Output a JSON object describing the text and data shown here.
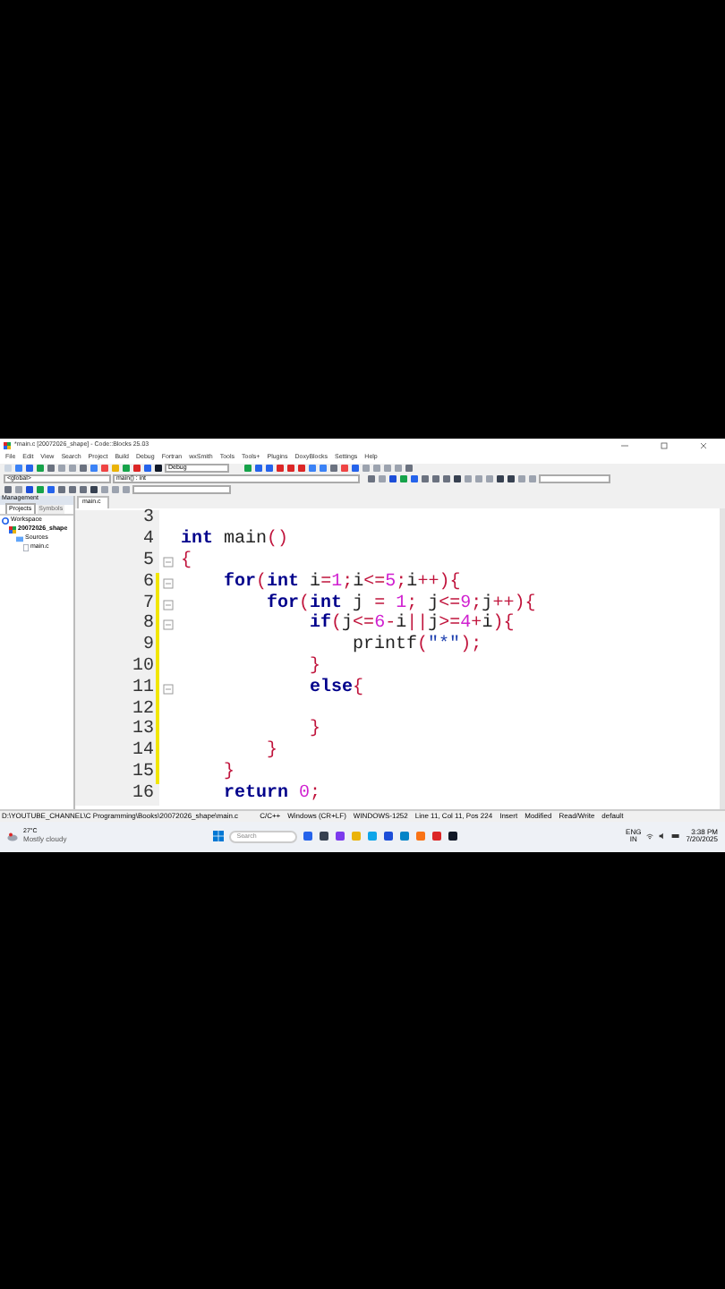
{
  "window": {
    "title": "*main.c [20072026_shape] - Code::Blocks 25.03"
  },
  "menu": [
    "File",
    "Edit",
    "View",
    "Search",
    "Project",
    "Build",
    "Debug",
    "Fortran",
    "wxSmith",
    "Tools",
    "Tools+",
    "Plugins",
    "DoxyBlocks",
    "Settings",
    "Help"
  ],
  "toolbar": {
    "build_target": "Debug",
    "scope": "<global>",
    "function": "main() : int"
  },
  "management": {
    "title": "Management",
    "tabs": [
      {
        "label": "Projects",
        "selected": true
      },
      {
        "label": "Symbols",
        "selected": false
      }
    ],
    "tree": [
      {
        "label": "Workspace",
        "kind": "workspace",
        "children": [
          {
            "label": "20072026_shape",
            "kind": "project",
            "children": [
              {
                "label": "Sources",
                "kind": "folder",
                "children": [
                  {
                    "label": "main.c",
                    "kind": "file"
                  }
                ]
              }
            ]
          }
        ]
      }
    ]
  },
  "editor": {
    "tab": "main.c",
    "lines": [
      {
        "number": "3",
        "fold": false,
        "changed": false
      },
      {
        "number": "4",
        "fold": false,
        "changed": false,
        "tokens": [
          {
            "kind": "keyword",
            "text": "int"
          },
          {
            "kind": "plain",
            "text": " main"
          },
          {
            "kind": "op",
            "text": "()"
          }
        ]
      },
      {
        "number": "5",
        "fold": true,
        "changed": false,
        "tokens": [
          {
            "kind": "op",
            "text": "{"
          }
        ]
      },
      {
        "number": "6",
        "fold": true,
        "changed": true,
        "tokens": [
          {
            "kind": "keyword",
            "text": "    for"
          },
          {
            "kind": "op",
            "text": "("
          },
          {
            "kind": "keyword",
            "text": "int"
          },
          {
            "kind": "plain",
            "text": " i"
          },
          {
            "kind": "op",
            "text": "="
          },
          {
            "kind": "number",
            "text": "1"
          },
          {
            "kind": "op",
            "text": ";"
          },
          {
            "kind": "plain",
            "text": "i"
          },
          {
            "kind": "op",
            "text": "<="
          },
          {
            "kind": "number",
            "text": "5"
          },
          {
            "kind": "op",
            "text": ";"
          },
          {
            "kind": "plain",
            "text": "i"
          },
          {
            "kind": "op",
            "text": "++){"
          }
        ]
      },
      {
        "number": "7",
        "fold": true,
        "changed": true,
        "tokens": [
          {
            "kind": "keyword",
            "text": "        for"
          },
          {
            "kind": "op",
            "text": "("
          },
          {
            "kind": "keyword",
            "text": "int"
          },
          {
            "kind": "plain",
            "text": " j "
          },
          {
            "kind": "op",
            "text": "="
          },
          {
            "kind": "number",
            "text": " 1"
          },
          {
            "kind": "op",
            "text": ";"
          },
          {
            "kind": "plain",
            "text": " j"
          },
          {
            "kind": "op",
            "text": "<="
          },
          {
            "kind": "number",
            "text": "9"
          },
          {
            "kind": "op",
            "text": ";"
          },
          {
            "kind": "plain",
            "text": "j"
          },
          {
            "kind": "op",
            "text": "++){"
          }
        ]
      },
      {
        "number": "8",
        "fold": true,
        "changed": true,
        "tokens": [
          {
            "kind": "keyword",
            "text": "            if"
          },
          {
            "kind": "op",
            "text": "("
          },
          {
            "kind": "plain",
            "text": "j"
          },
          {
            "kind": "op",
            "text": "<="
          },
          {
            "kind": "number",
            "text": "6"
          },
          {
            "kind": "op",
            "text": "-"
          },
          {
            "kind": "plain",
            "text": "i"
          },
          {
            "kind": "op",
            "text": "||"
          },
          {
            "kind": "plain",
            "text": "j"
          },
          {
            "kind": "op",
            "text": ">="
          },
          {
            "kind": "number",
            "text": "4"
          },
          {
            "kind": "op",
            "text": "+"
          },
          {
            "kind": "plain",
            "text": "i"
          },
          {
            "kind": "op",
            "text": "){"
          }
        ]
      },
      {
        "number": "9",
        "fold": false,
        "changed": true,
        "tokens": [
          {
            "kind": "plain",
            "text": "                printf"
          },
          {
            "kind": "op",
            "text": "("
          },
          {
            "kind": "string",
            "text": "\"*\""
          },
          {
            "kind": "op",
            "text": ");"
          }
        ]
      },
      {
        "number": "10",
        "fold": false,
        "changed": true,
        "tokens": [
          {
            "kind": "op",
            "text": "            }"
          }
        ]
      },
      {
        "number": "11",
        "fold": true,
        "changed": true,
        "tokens": [
          {
            "kind": "keyword",
            "text": "            else"
          },
          {
            "kind": "op",
            "text": "{"
          }
        ]
      },
      {
        "number": "12",
        "fold": false,
        "changed": true
      },
      {
        "number": "13",
        "fold": false,
        "changed": true,
        "tokens": [
          {
            "kind": "op",
            "text": "            }"
          }
        ]
      },
      {
        "number": "14",
        "fold": false,
        "changed": true,
        "tokens": [
          {
            "kind": "op",
            "text": "        }"
          }
        ]
      },
      {
        "number": "15",
        "fold": false,
        "changed": true,
        "tokens": [
          {
            "kind": "op",
            "text": "    }"
          }
        ]
      },
      {
        "number": "16",
        "fold": false,
        "changed": false,
        "tokens": [
          {
            "kind": "keyword",
            "text": "    return"
          },
          {
            "kind": "number",
            "text": " 0"
          },
          {
            "kind": "op",
            "text": ";"
          }
        ]
      }
    ]
  },
  "status_bar": [
    "D:\\YOUTUBE_CHANNEL\\C Programming\\Books\\20072026_shape\\main.c",
    "C/C++",
    "Windows (CR+LF)",
    "WINDOWS-1252",
    "Line 11, Col 11, Pos 224",
    "Insert",
    "Modified",
    "Read/Write",
    "default"
  ],
  "taskbar": {
    "weather": {
      "temp": "27°C",
      "text": "Mostly cloudy"
    },
    "search": {
      "placeholder": "Search"
    },
    "language": [
      "ENG",
      "IN"
    ],
    "time": "3:38 PM",
    "date": "7/20/2025"
  }
}
